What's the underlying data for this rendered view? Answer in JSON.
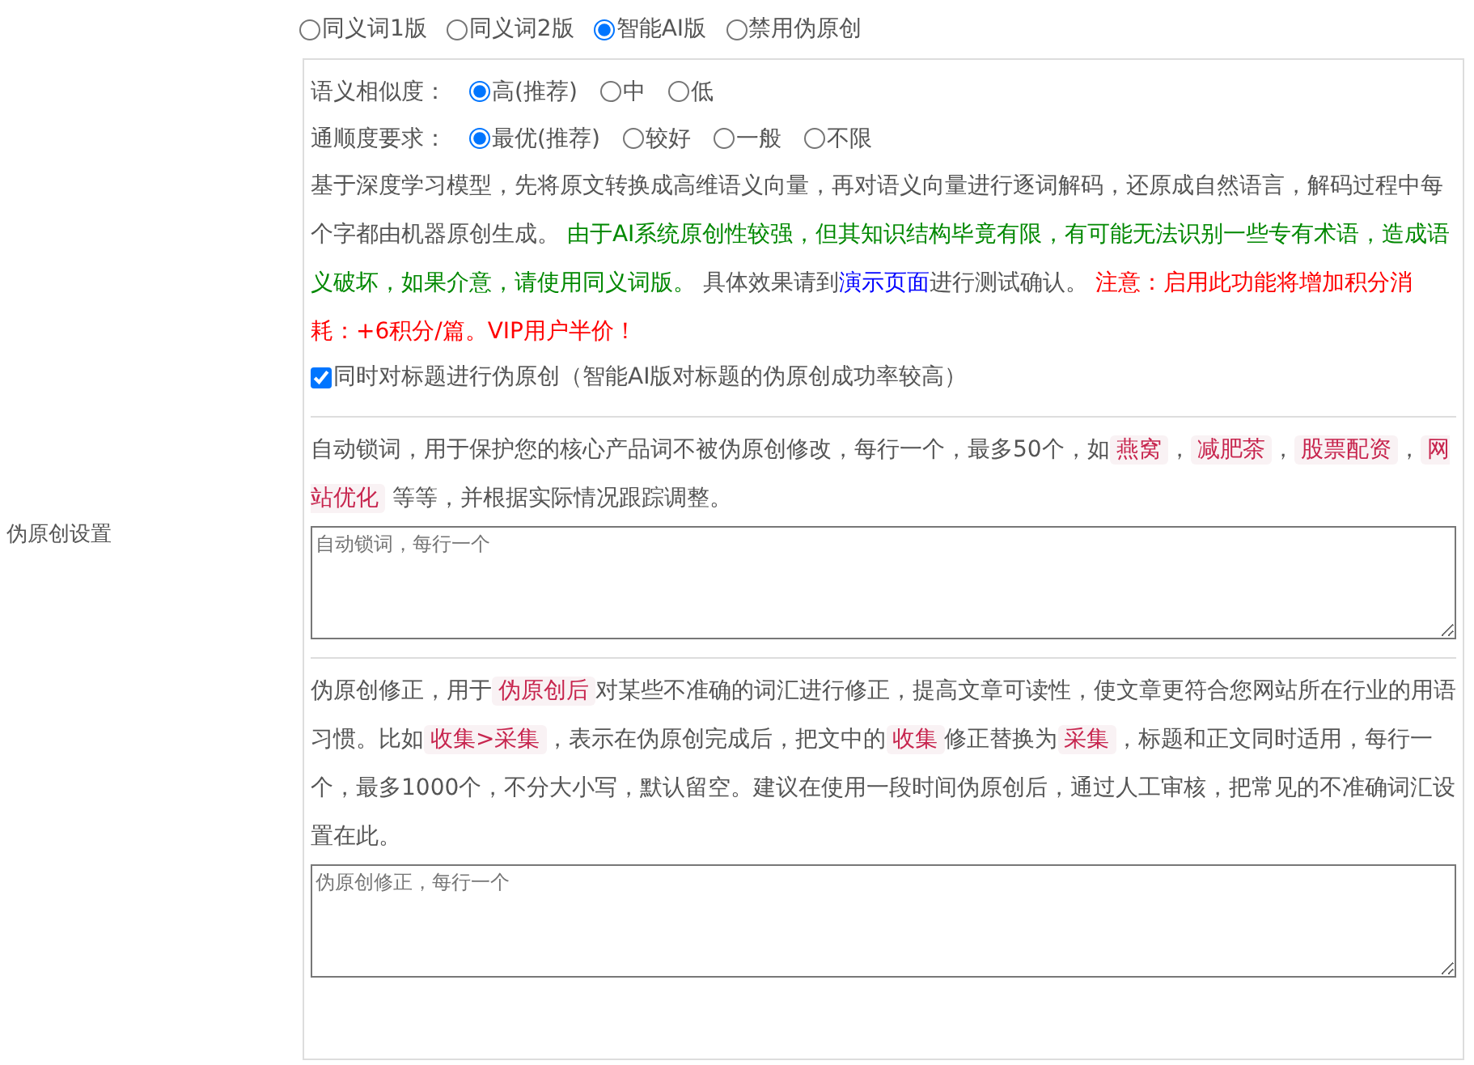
{
  "setting_label": "伪原创设置",
  "modes": [
    {
      "label": "同义词1版",
      "selected": false
    },
    {
      "label": "同义词2版",
      "selected": false
    },
    {
      "label": "智能AI版",
      "selected": true
    },
    {
      "label": "禁用伪原创",
      "selected": false
    }
  ],
  "similarity": {
    "label": "语义相似度：",
    "options": [
      {
        "label": "高(推荐)",
        "selected": true
      },
      {
        "label": "中",
        "selected": false
      },
      {
        "label": "低",
        "selected": false
      }
    ]
  },
  "fluency": {
    "label": "通顺度要求：",
    "options": [
      {
        "label": "最优(推荐)",
        "selected": true
      },
      {
        "label": "较好",
        "selected": false
      },
      {
        "label": "一般",
        "selected": false
      },
      {
        "label": "不限",
        "selected": false
      }
    ]
  },
  "ai_description": [
    {
      "kind": "text",
      "text": "基于深度学习模型，先将原文转换成高维语义向量，再对语义向量进行逐词解码，还原成自然语言，解码过程中每个字都由机器原创生成。 "
    },
    {
      "kind": "note",
      "text": "由于AI系统原创性较强，但其知识结构毕竟有限，有可能无法识别一些专有术语，造成语义破坏，如果介意，请使用同义词版。"
    },
    {
      "kind": "text",
      "text": " 具体效果请到"
    },
    {
      "kind": "link",
      "text": "演示页面"
    },
    {
      "kind": "text",
      "text": "进行测试确认。 "
    },
    {
      "kind": "warning",
      "text": "注意：启用此功能将增加积分消耗：+6积分/篇。VIP用户半价！"
    }
  ],
  "title_option": {
    "label": "同时对标题进行伪原创（智能AI版对标题的伪原创成功率较高）",
    "checked": true
  },
  "lock_words": {
    "description": [
      {
        "kind": "text",
        "text": "自动锁词，用于保护您的核心产品词不被伪原创修改，每行一个，最多50个，如"
      },
      {
        "kind": "code",
        "text": "燕窝"
      },
      {
        "kind": "text",
        "text": "，"
      },
      {
        "kind": "code",
        "text": "减肥茶"
      },
      {
        "kind": "text",
        "text": "，"
      },
      {
        "kind": "code",
        "text": "股票配资"
      },
      {
        "kind": "text",
        "text": "，"
      },
      {
        "kind": "code",
        "text": "网站优化"
      },
      {
        "kind": "text",
        "text": " 等等，并根据实际情况跟踪调整。"
      }
    ],
    "placeholder": "自动锁词，每行一个"
  },
  "corrections": {
    "description": [
      {
        "kind": "text",
        "text": "伪原创修正，用于"
      },
      {
        "kind": "code",
        "text": "伪原创后"
      },
      {
        "kind": "text",
        "text": "对某些不准确的词汇进行修正，提高文章可读性，使文章更符合您网站所在行业的用语习惯。比如"
      },
      {
        "kind": "code",
        "text": "收集>采集"
      },
      {
        "kind": "text",
        "text": "，表示在伪原创完成后，把文中的"
      },
      {
        "kind": "code",
        "text": "收集"
      },
      {
        "kind": "text",
        "text": "修正替换为"
      },
      {
        "kind": "code",
        "text": "采集"
      },
      {
        "kind": "text",
        "text": "，标题和正文同时适用，每行一个，最多1000个，不分大小写，默认留空。建议在使用一段时间伪原创后，通过人工审核，把常见的不准确词汇设置在此。"
      }
    ],
    "placeholder": "伪原创修正，每行一个"
  }
}
